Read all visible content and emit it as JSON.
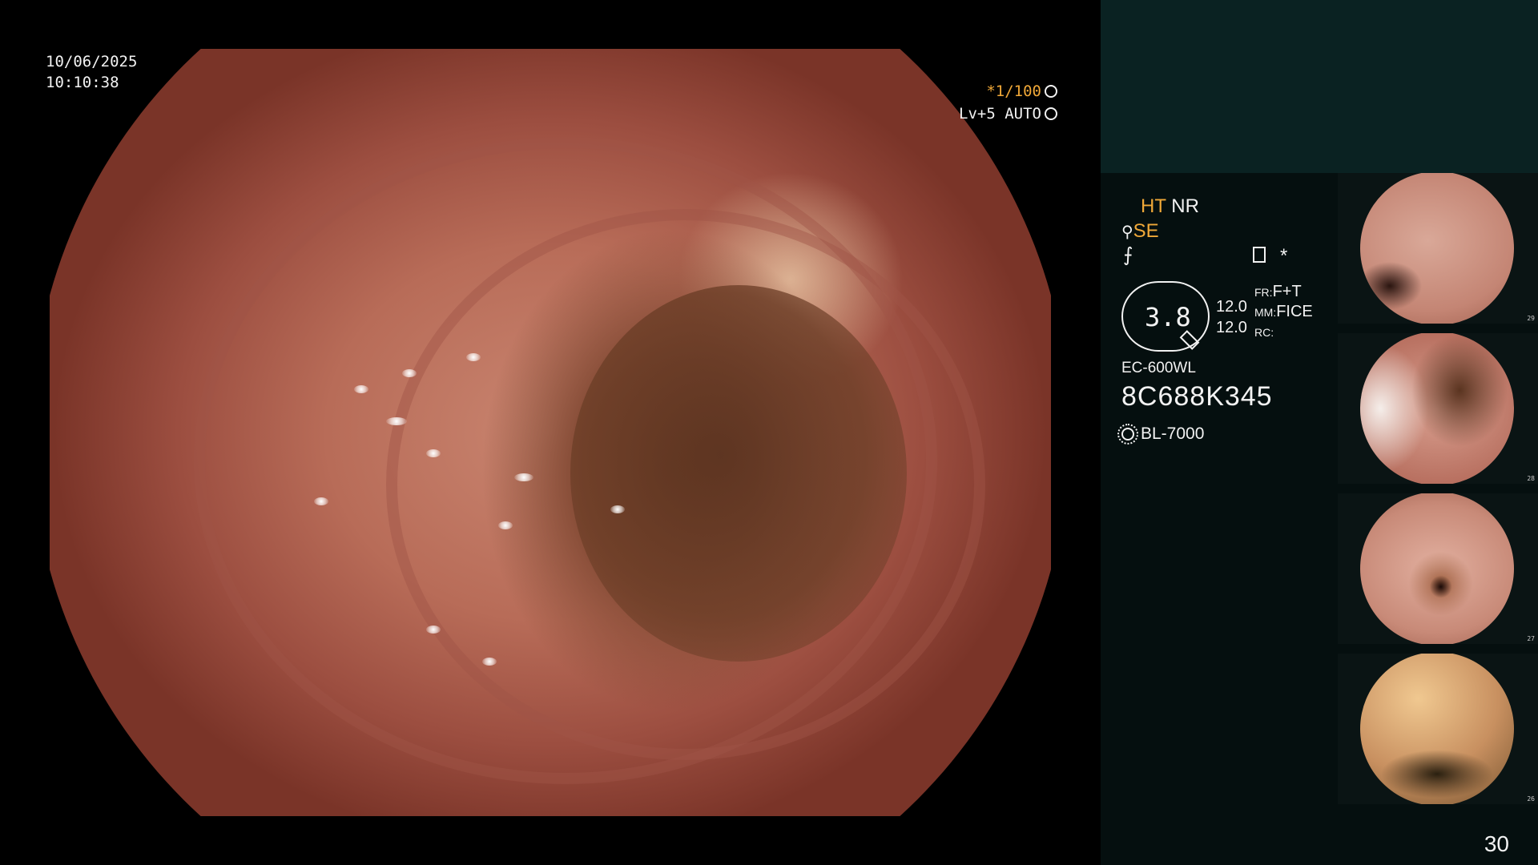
{
  "overlay": {
    "date": "10/06/2025",
    "time": "10:10:38",
    "shutter": "*1/100",
    "level": "Lv+5 AUTO"
  },
  "panel": {
    "ht": "HT",
    "nr": "NR",
    "se": "SE",
    "scale_value": "3.8",
    "num1": "12.0",
    "num2": "12.0",
    "fr_label": "FR:",
    "fr_value": "F+T",
    "mm_label": "MM:",
    "mm_value": "FICE",
    "rc_label": "RC:",
    "scope_model": "EC-600WL",
    "serial": "8C688K345",
    "light_source": "BL-7000",
    "star": "*"
  },
  "thumbnails": [
    {
      "index": "29"
    },
    {
      "index": "28"
    },
    {
      "index": "27"
    },
    {
      "index": "26"
    }
  ],
  "page_number": "30",
  "colors": {
    "accent": "#f0a838",
    "panel_top": "#0a2222",
    "panel_bottom": "#050f0f",
    "mucosa": "#b86c58"
  }
}
